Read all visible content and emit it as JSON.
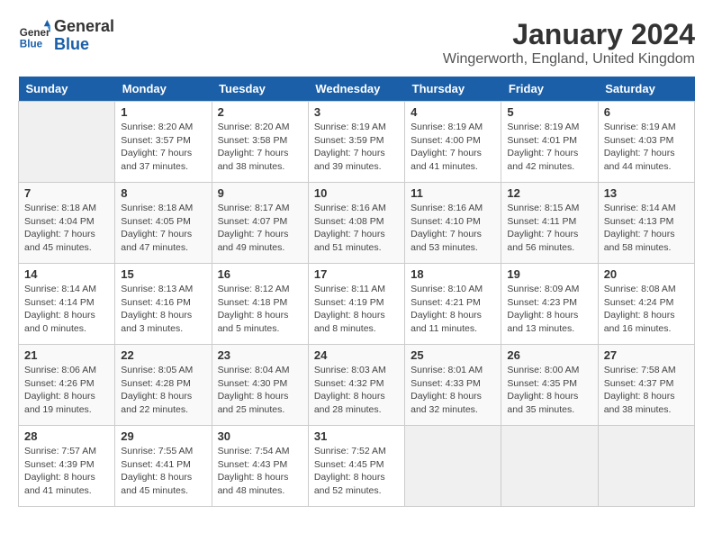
{
  "header": {
    "logo_text_general": "General",
    "logo_text_blue": "Blue",
    "month_title": "January 2024",
    "location": "Wingerworth, England, United Kingdom"
  },
  "calendar": {
    "weekdays": [
      "Sunday",
      "Monday",
      "Tuesday",
      "Wednesday",
      "Thursday",
      "Friday",
      "Saturday"
    ],
    "weeks": [
      [
        {
          "day": "",
          "info": ""
        },
        {
          "day": "1",
          "info": "Sunrise: 8:20 AM\nSunset: 3:57 PM\nDaylight: 7 hours\nand 37 minutes."
        },
        {
          "day": "2",
          "info": "Sunrise: 8:20 AM\nSunset: 3:58 PM\nDaylight: 7 hours\nand 38 minutes."
        },
        {
          "day": "3",
          "info": "Sunrise: 8:19 AM\nSunset: 3:59 PM\nDaylight: 7 hours\nand 39 minutes."
        },
        {
          "day": "4",
          "info": "Sunrise: 8:19 AM\nSunset: 4:00 PM\nDaylight: 7 hours\nand 41 minutes."
        },
        {
          "day": "5",
          "info": "Sunrise: 8:19 AM\nSunset: 4:01 PM\nDaylight: 7 hours\nand 42 minutes."
        },
        {
          "day": "6",
          "info": "Sunrise: 8:19 AM\nSunset: 4:03 PM\nDaylight: 7 hours\nand 44 minutes."
        }
      ],
      [
        {
          "day": "7",
          "info": "Sunrise: 8:18 AM\nSunset: 4:04 PM\nDaylight: 7 hours\nand 45 minutes."
        },
        {
          "day": "8",
          "info": "Sunrise: 8:18 AM\nSunset: 4:05 PM\nDaylight: 7 hours\nand 47 minutes."
        },
        {
          "day": "9",
          "info": "Sunrise: 8:17 AM\nSunset: 4:07 PM\nDaylight: 7 hours\nand 49 minutes."
        },
        {
          "day": "10",
          "info": "Sunrise: 8:16 AM\nSunset: 4:08 PM\nDaylight: 7 hours\nand 51 minutes."
        },
        {
          "day": "11",
          "info": "Sunrise: 8:16 AM\nSunset: 4:10 PM\nDaylight: 7 hours\nand 53 minutes."
        },
        {
          "day": "12",
          "info": "Sunrise: 8:15 AM\nSunset: 4:11 PM\nDaylight: 7 hours\nand 56 minutes."
        },
        {
          "day": "13",
          "info": "Sunrise: 8:14 AM\nSunset: 4:13 PM\nDaylight: 7 hours\nand 58 minutes."
        }
      ],
      [
        {
          "day": "14",
          "info": "Sunrise: 8:14 AM\nSunset: 4:14 PM\nDaylight: 8 hours\nand 0 minutes."
        },
        {
          "day": "15",
          "info": "Sunrise: 8:13 AM\nSunset: 4:16 PM\nDaylight: 8 hours\nand 3 minutes."
        },
        {
          "day": "16",
          "info": "Sunrise: 8:12 AM\nSunset: 4:18 PM\nDaylight: 8 hours\nand 5 minutes."
        },
        {
          "day": "17",
          "info": "Sunrise: 8:11 AM\nSunset: 4:19 PM\nDaylight: 8 hours\nand 8 minutes."
        },
        {
          "day": "18",
          "info": "Sunrise: 8:10 AM\nSunset: 4:21 PM\nDaylight: 8 hours\nand 11 minutes."
        },
        {
          "day": "19",
          "info": "Sunrise: 8:09 AM\nSunset: 4:23 PM\nDaylight: 8 hours\nand 13 minutes."
        },
        {
          "day": "20",
          "info": "Sunrise: 8:08 AM\nSunset: 4:24 PM\nDaylight: 8 hours\nand 16 minutes."
        }
      ],
      [
        {
          "day": "21",
          "info": "Sunrise: 8:06 AM\nSunset: 4:26 PM\nDaylight: 8 hours\nand 19 minutes."
        },
        {
          "day": "22",
          "info": "Sunrise: 8:05 AM\nSunset: 4:28 PM\nDaylight: 8 hours\nand 22 minutes."
        },
        {
          "day": "23",
          "info": "Sunrise: 8:04 AM\nSunset: 4:30 PM\nDaylight: 8 hours\nand 25 minutes."
        },
        {
          "day": "24",
          "info": "Sunrise: 8:03 AM\nSunset: 4:32 PM\nDaylight: 8 hours\nand 28 minutes."
        },
        {
          "day": "25",
          "info": "Sunrise: 8:01 AM\nSunset: 4:33 PM\nDaylight: 8 hours\nand 32 minutes."
        },
        {
          "day": "26",
          "info": "Sunrise: 8:00 AM\nSunset: 4:35 PM\nDaylight: 8 hours\nand 35 minutes."
        },
        {
          "day": "27",
          "info": "Sunrise: 7:58 AM\nSunset: 4:37 PM\nDaylight: 8 hours\nand 38 minutes."
        }
      ],
      [
        {
          "day": "28",
          "info": "Sunrise: 7:57 AM\nSunset: 4:39 PM\nDaylight: 8 hours\nand 41 minutes."
        },
        {
          "day": "29",
          "info": "Sunrise: 7:55 AM\nSunset: 4:41 PM\nDaylight: 8 hours\nand 45 minutes."
        },
        {
          "day": "30",
          "info": "Sunrise: 7:54 AM\nSunset: 4:43 PM\nDaylight: 8 hours\nand 48 minutes."
        },
        {
          "day": "31",
          "info": "Sunrise: 7:52 AM\nSunset: 4:45 PM\nDaylight: 8 hours\nand 52 minutes."
        },
        {
          "day": "",
          "info": ""
        },
        {
          "day": "",
          "info": ""
        },
        {
          "day": "",
          "info": ""
        }
      ]
    ]
  }
}
